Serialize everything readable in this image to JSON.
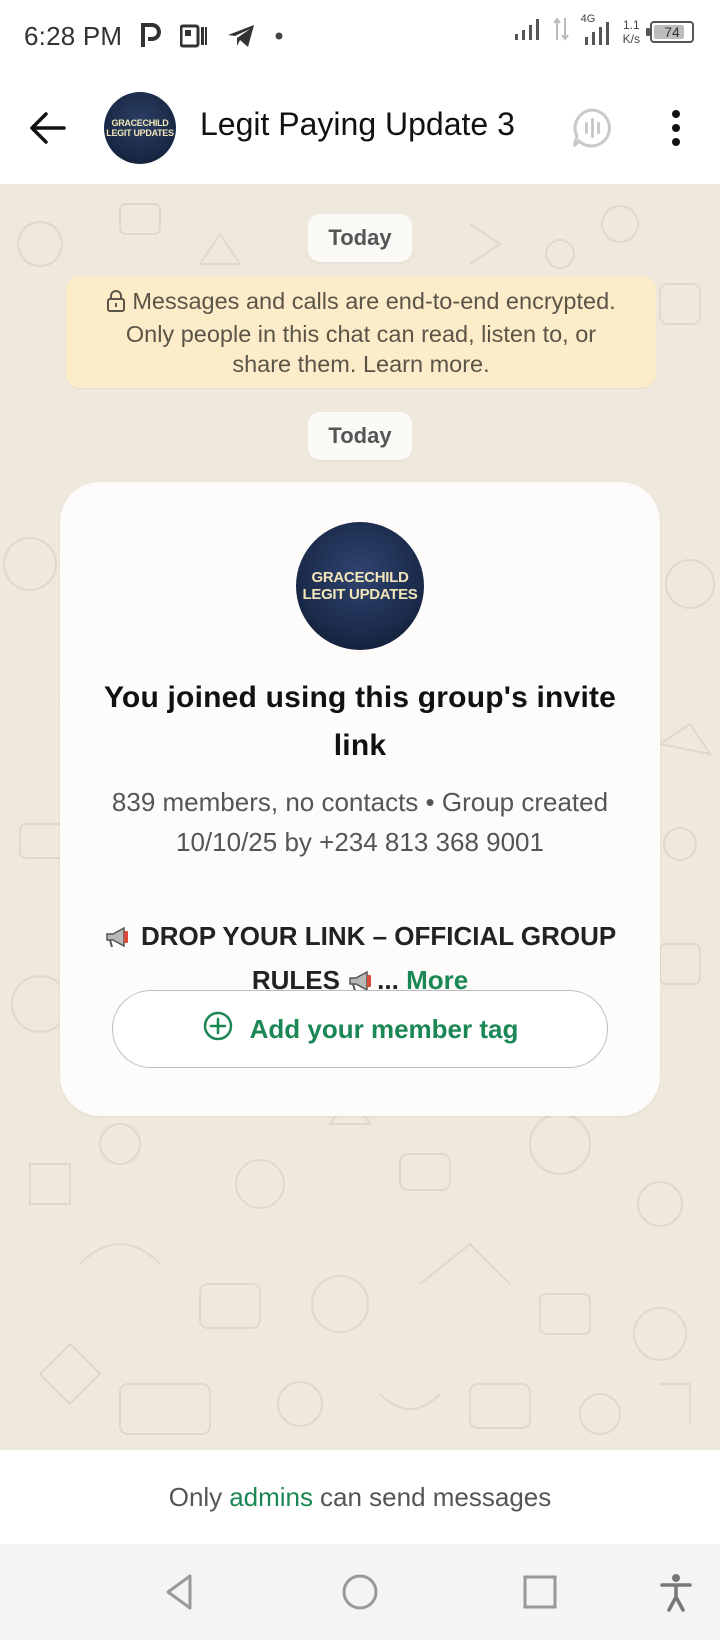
{
  "status_bar": {
    "time": "6:28 PM",
    "network": "4G",
    "speed_value": "1.1",
    "speed_unit": "K/s",
    "battery": "74",
    "icons": [
      "parking-p-icon",
      "app-notification-icon",
      "telegram-icon",
      "dot-icon",
      "signal-icon",
      "data-arrows-icon",
      "signal-4g-icon"
    ]
  },
  "header": {
    "title": "Legit Paying Update 3",
    "avatar_line1": "GRACECHILD",
    "avatar_line2": "LEGIT UPDATES"
  },
  "chat": {
    "date_chip_1": "Today",
    "date_chip_2": "Today",
    "encryption_notice": "Messages and calls are end-to-end encrypted. Only people in this chat can read, listen to, or share them. Learn more.",
    "invite_card": {
      "avatar_line1": "GRACECHILD",
      "avatar_line2": "LEGIT UPDATES",
      "title": "You joined using this group's invite link",
      "meta": "839 members, no contacts • Group created 10/10/25 by +234 813 368 9001",
      "desc_part1": " DROP YOUR LINK – OFFICIAL GROUP RULES ",
      "desc_ellipsis": "...",
      "more": "More",
      "member_tag_button": "Add your member tag"
    }
  },
  "footer": {
    "prefix": "Only",
    "admins": "admins",
    "suffix": "can send messages"
  },
  "colors": {
    "accent_green": "#1b8755",
    "chat_bg": "#efe8dd",
    "notice_bg": "#fcecc9"
  }
}
